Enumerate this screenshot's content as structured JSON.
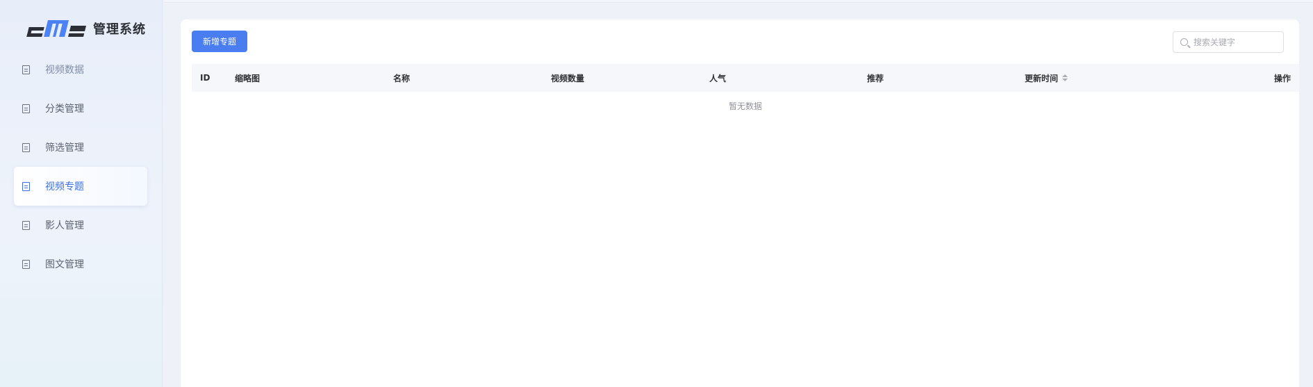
{
  "app": {
    "logo_text": "cms",
    "title": "管理系统"
  },
  "sidebar": {
    "items": [
      {
        "label": "视频数据",
        "active": false
      },
      {
        "label": "分类管理",
        "active": false
      },
      {
        "label": "筛选管理",
        "active": false
      },
      {
        "label": "视频专题",
        "active": true
      },
      {
        "label": "影人管理",
        "active": false
      },
      {
        "label": "图文管理",
        "active": false
      }
    ]
  },
  "toolbar": {
    "add_label": "新增专题",
    "search_placeholder": "搜索关键字"
  },
  "table": {
    "columns": [
      "ID",
      "缩略图",
      "名称",
      "视频数量",
      "人气",
      "推荐",
      "更新时间",
      "操作"
    ],
    "rows": [],
    "empty_text": "暂无数据"
  },
  "colors": {
    "accent": "#4a7df0",
    "active_text": "#3b6fe6"
  }
}
